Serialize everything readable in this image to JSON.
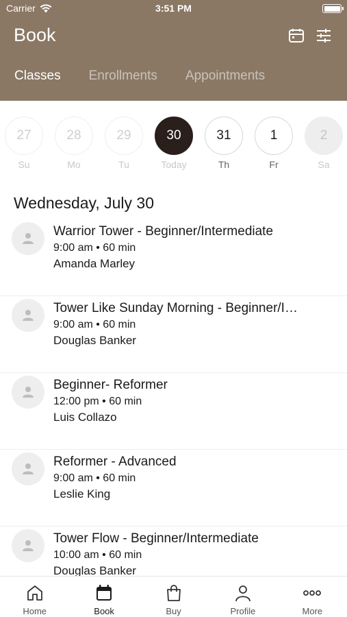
{
  "status_bar": {
    "carrier": "Carrier",
    "time": "3:51 PM"
  },
  "header": {
    "title": "Book",
    "tabs": [
      {
        "label": "Classes",
        "active": true
      },
      {
        "label": "Enrollments",
        "active": false
      },
      {
        "label": "Appointments",
        "active": false
      }
    ]
  },
  "days": [
    {
      "num": "27",
      "label": "Su",
      "state": "past"
    },
    {
      "num": "28",
      "label": "Mo",
      "state": "past"
    },
    {
      "num": "29",
      "label": "Tu",
      "state": "past"
    },
    {
      "num": "30",
      "label": "Today",
      "state": "today"
    },
    {
      "num": "31",
      "label": "Th",
      "state": "future"
    },
    {
      "num": "1",
      "label": "Fr",
      "state": "future"
    },
    {
      "num": "2",
      "label": "Sa",
      "state": "unavail"
    }
  ],
  "date_heading": "Wednesday, July 30",
  "classes": [
    {
      "title": "Warrior Tower - Beginner/Intermediate",
      "time": "9:00 am • 60 min",
      "instructor": "Amanda Marley"
    },
    {
      "title": "Tower Like Sunday Morning - Beginner/I…",
      "time": "9:00 am • 60 min",
      "instructor": "Douglas Banker"
    },
    {
      "title": "Beginner- Reformer",
      "time": "12:00 pm • 60 min",
      "instructor": "Luis Collazo"
    },
    {
      "title": "Reformer - Advanced",
      "time": "9:00 am • 60 min",
      "instructor": "Leslie King"
    },
    {
      "title": "Tower Flow - Beginner/Intermediate",
      "time": "10:00 am • 60 min",
      "instructor": "Douglas Banker"
    }
  ],
  "tabbar": [
    {
      "label": "Home",
      "icon": "home-icon"
    },
    {
      "label": "Book",
      "icon": "calendar-icon"
    },
    {
      "label": "Buy",
      "icon": "shopping-bag-icon"
    },
    {
      "label": "Profile",
      "icon": "person-icon"
    },
    {
      "label": "More",
      "icon": "more-dots-icon"
    }
  ],
  "colors": {
    "header": "#8b7864",
    "today": "#2a1f1a"
  }
}
